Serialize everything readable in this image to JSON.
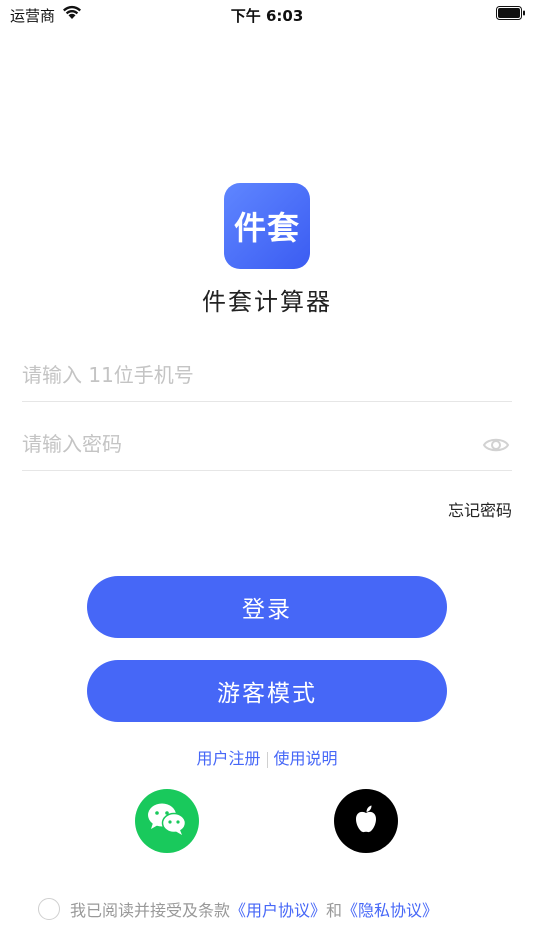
{
  "status_bar": {
    "carrier": "运营商",
    "time": "下午 6:03"
  },
  "app": {
    "logo_text": "件套",
    "name": "件套计算器"
  },
  "form": {
    "phone_placeholder": "请输入 11位手机号",
    "password_placeholder": "请输入密码",
    "forgot_password": "忘记密码"
  },
  "buttons": {
    "login": "登录",
    "guest": "游客模式"
  },
  "links": {
    "register": "用户注册",
    "instructions": "使用说明"
  },
  "social": {
    "wechat_icon": "wechat-icon",
    "apple_icon": "apple-icon"
  },
  "agreement": {
    "prefix": "我已阅读并接受及条款",
    "user_agreement": "《用户协议》",
    "and": "和",
    "privacy_policy": "《隐私协议》",
    "checked": false
  },
  "colors": {
    "primary": "#4667f7",
    "wechat": "#19c95c",
    "apple": "#000000"
  }
}
